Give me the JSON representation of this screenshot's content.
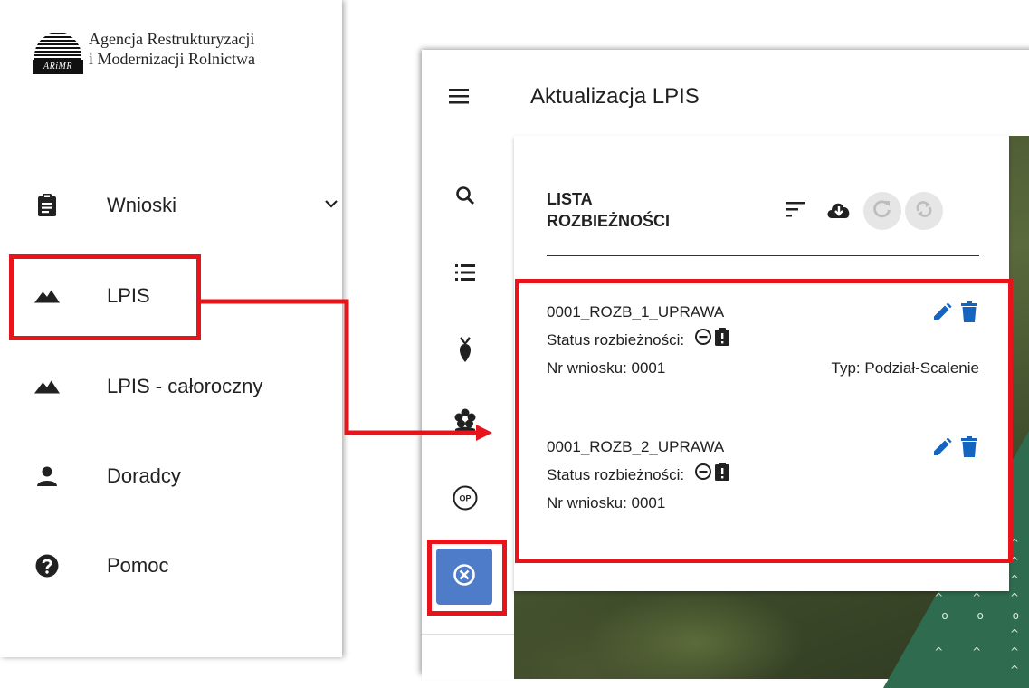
{
  "agency": {
    "logo_text": "ARiMR",
    "name_line1": "Agencja Restrukturyzacji",
    "name_line2": "i Modernizacji Rolnictwa"
  },
  "nav": {
    "items": [
      {
        "label": "Wnioski",
        "icon": "clipboard-icon",
        "has_chevron": true
      },
      {
        "label": "LPIS",
        "icon": "terrain-icon"
      },
      {
        "label": "LPIS - całoroczny",
        "icon": "terrain-icon"
      },
      {
        "label": "Doradcy",
        "icon": "person-icon"
      },
      {
        "label": "Pomoc",
        "icon": "help-icon"
      }
    ]
  },
  "app": {
    "title": "Aktualizacja LPIS",
    "tools": [
      "search-icon",
      "list-icon",
      "crop-icon",
      "flower-settings-icon",
      "op-icon",
      "close-circle-icon"
    ],
    "tool_op_label": "OP"
  },
  "panel": {
    "title_line1": "LISTA",
    "title_line2": "ROZBIEŻNOŚCI",
    "actions": [
      "sort-icon",
      "cloud-download-icon",
      "refresh-icon",
      "sync-icon"
    ],
    "items": [
      {
        "name": "0001_ROZB_1_UPRAWA",
        "status_label": "Status rozbieżności:",
        "nr_label": "Nr wniosku: 0001",
        "type_label": "Typ: Podział-Scalenie"
      },
      {
        "name": "0001_ROZB_2_UPRAWA",
        "status_label": "Status rozbieżności:",
        "nr_label": "Nr wniosku: 0001"
      }
    ]
  },
  "colors": {
    "highlight": "#e8141c",
    "accent_blue": "#1565c0",
    "close_button": "#4f7cc9"
  }
}
